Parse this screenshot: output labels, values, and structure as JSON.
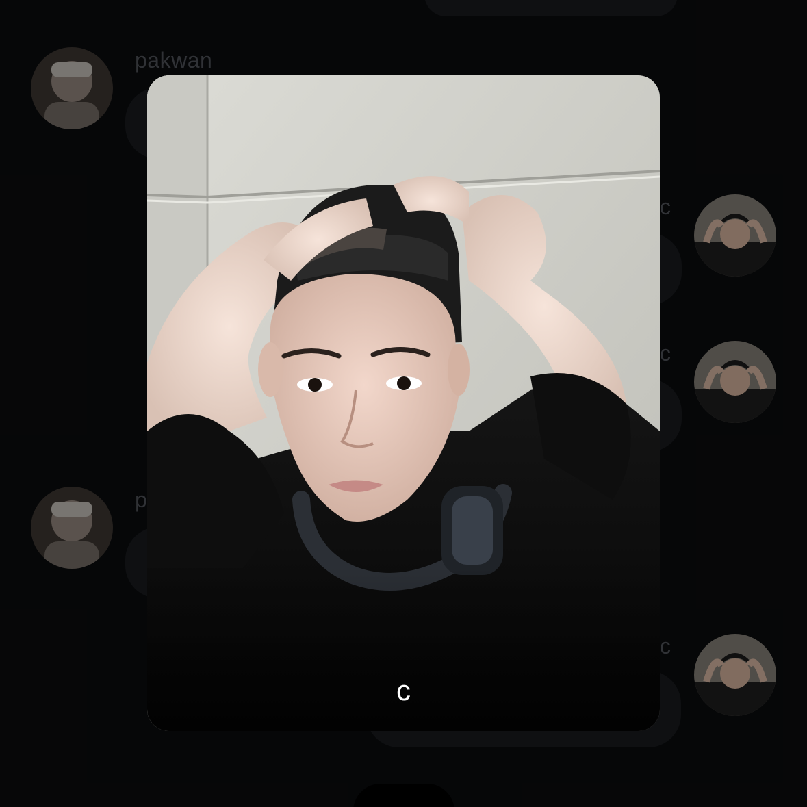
{
  "chat": {
    "sender_name": "pakwan",
    "sender_name_truncated": "p",
    "my_name_fragment": "c",
    "messages": [
      {
        "side": "left",
        "avatar": "user-avatar"
      },
      {
        "side": "right",
        "avatar": "self-avatar"
      },
      {
        "side": "right",
        "avatar": "self-avatar"
      },
      {
        "side": "left",
        "avatar": "user-avatar"
      },
      {
        "side": "right",
        "avatar": "self-avatar"
      }
    ]
  },
  "preview": {
    "caption": "c",
    "image": "selfie-photo"
  },
  "colors": {
    "background": "#0a0b0d",
    "bubble": "#17191d",
    "caption": "#ffffff",
    "name": "#4a4d53"
  }
}
